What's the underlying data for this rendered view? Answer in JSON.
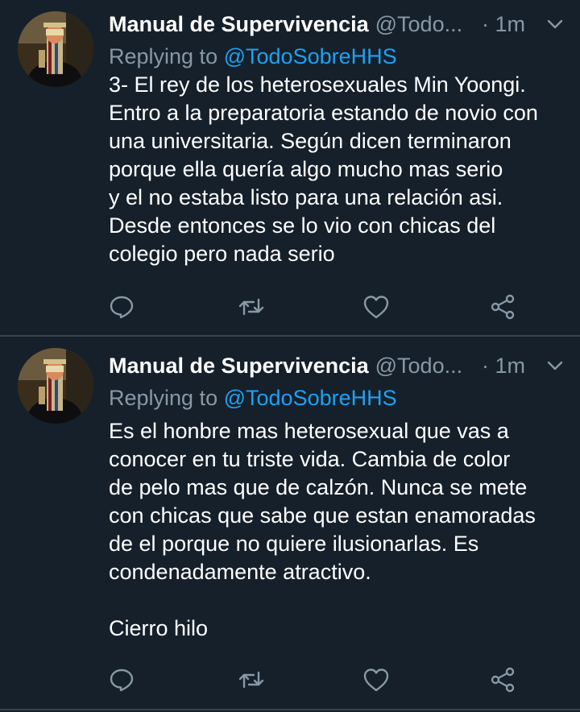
{
  "tweets": [
    {
      "author_name": "Manual de Supervivencia",
      "author_handle": "@Todo...",
      "time_sep": "·",
      "time": "1m",
      "replying_prefix": "Replying to",
      "replying_mention": "@TodoSobreHHS",
      "lines": [
        "3- El rey de los heterosexuales Min Yoongi.",
        "Entro a la preparatoria estando de novio con",
        "una universitaria. Según dicen terminaron",
        "porque ella quería algo mucho mas serio",
        "y el no estaba listo para una relación asi.",
        "Desde entonces se lo vio con chicas del",
        "colegio pero nada serio"
      ]
    },
    {
      "author_name": "Manual de Supervivencia",
      "author_handle": "@Todo...",
      "time_sep": "·",
      "time": "1m",
      "replying_prefix": "Replying to",
      "replying_mention": "@TodoSobreHHS",
      "lines": [
        "Es el honbre mas heterosexual que vas a",
        "conocer en tu triste vida. Cambia de color",
        "de pelo mas que de calzón. Nunca se mete",
        "con chicas que sabe que estan enamoradas",
        "de el porque no quiere ilusionarlas. Es",
        "condenadamente atractivo.",
        "",
        "Cierro hilo"
      ]
    }
  ],
  "colors": {
    "background": "#15202b",
    "secondary_text": "#8899a6",
    "accent": "#1da1f2",
    "divider": "#38444d"
  },
  "icons": [
    "reply-icon",
    "retweet-icon",
    "like-icon",
    "share-icon",
    "chevron-down-icon"
  ]
}
